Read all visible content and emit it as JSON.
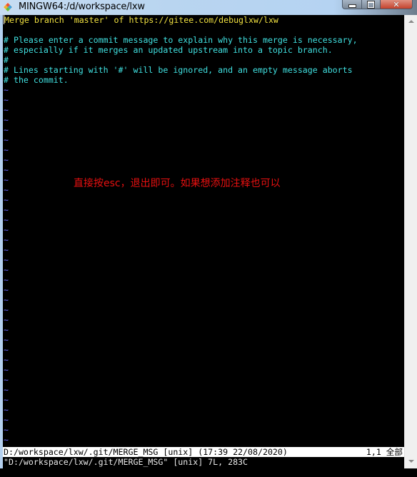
{
  "window": {
    "title": "MINGW64:/d/workspace/lxw",
    "icon": "git-bash-icon",
    "buttons": {
      "minimize": "minimize-icon",
      "maximize": "maximize-icon",
      "close": "close-icon"
    }
  },
  "editor": {
    "lines": [
      {
        "text": "Merge branch 'master' of https://gitee.com/debuglxw/lxw",
        "color": "yellow"
      },
      {
        "text": "",
        "color": "cyan"
      },
      {
        "text": "# Please enter a commit message to explain why this merge is necessary,",
        "color": "cyan"
      },
      {
        "text": "# especially if it merges an updated upstream into a topic branch.",
        "color": "cyan"
      },
      {
        "text": "#",
        "color": "cyan"
      },
      {
        "text": "# Lines starting with '#' will be ignored, and an empty message aborts",
        "color": "cyan"
      },
      {
        "text": "# the commit.",
        "color": "cyan"
      }
    ],
    "empty_line_marker": "~",
    "empty_line_count": 36,
    "colors": {
      "yellow": "#f0e040",
      "cyan": "#40e0e0",
      "tilde": "#6666ff"
    }
  },
  "annotation": {
    "text": "直接按esc，退出即可。如果想添加注释也可以",
    "color": "#e81010"
  },
  "statusline": {
    "left": "D:/workspace/lxw/.git/MERGE_MSG [unix] (17:39 22/08/2020)",
    "right": "1,1 全部"
  },
  "messageline": {
    "text": "\"D:/workspace/lxw/.git/MERGE_MSG\" [unix] 7L, 283C"
  },
  "scrollbar": {
    "up": "scroll-up-arrow-icon",
    "down": "scroll-down-arrow-icon"
  }
}
